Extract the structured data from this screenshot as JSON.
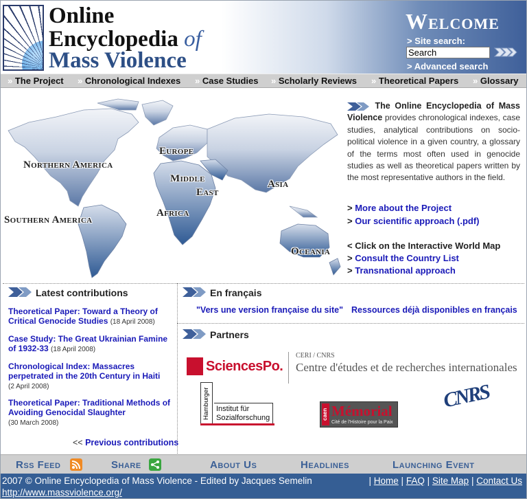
{
  "header": {
    "title_line1": "Online",
    "title_line2": "Encyclopedia",
    "title_of": "of",
    "title_line3": "Mass Violence",
    "welcome": "Welcome",
    "site_search_label": "> Site search:",
    "search_value": "Search",
    "advanced_search": "> Advanced search"
  },
  "nav": [
    "The Project",
    "Chronological Indexes",
    "Case Studies",
    "Scholarly Reviews",
    "Theoretical Papers",
    "Glossary"
  ],
  "map": {
    "regions": [
      "Northern America",
      "Europe",
      "Middle",
      "East",
      "Asia",
      "Africa",
      "Southern America",
      "Oceania"
    ]
  },
  "intro": {
    "lead": "The Online Encyclopedia of Mass Violence",
    "body": " provides chronological indexes, case studies, analytical contributions on socio-political violence in a given country, a glossary of the terms most often used in genocide studies as well as theoretical papers written by the most representative authors in the field.",
    "more_about": "More about the Project",
    "scientific": "Our scientific approach (.pdf)",
    "click_map": "< Click on the Interactive World Map",
    "country_list": "Consult the Country List",
    "transnational": "Transnational approach",
    "gt": ">"
  },
  "latest": {
    "heading": "Latest contributions",
    "items": [
      {
        "title": "Theoretical Paper: Toward a Theory of Critical Genocide Studies",
        "date": "(18 April 2008)"
      },
      {
        "title": "Case Study: The Great Ukrainian Famine of 1932-33",
        "date": "(18 April 2008)"
      },
      {
        "title": "Chronological Index: Massacres perpetrated in the 20th Century in Haiti",
        "date": "(2 April 2008)"
      },
      {
        "title": "Theoretical Paper: Traditional Methods of Avoiding Genocidal Slaughter",
        "date": "(30 March 2008)"
      }
    ],
    "previous_prefix": "<<",
    "previous": "Previous contributions"
  },
  "french": {
    "heading": "En français",
    "link1": "\"Vers une version française du site\"",
    "link2": "Ressources déjà disponibles en français"
  },
  "partners": {
    "heading": "Partners",
    "sciencespo": "SciencesPo.",
    "ceri_small": "CERI / CNRS",
    "ceri_big": "Centre d'études et de recherches internationales",
    "hamburger_vertical": "Hamburger",
    "hamburger_text": "Institut für Sozialforschung",
    "memorial_caen": "caen",
    "memorial_big": "Mémorial",
    "memorial_small": "Cité de l'Histoire pour la Paix",
    "cnrs": "CNRS"
  },
  "footer": {
    "rss": "Rss Feed",
    "share": "Share",
    "about": "About Us",
    "headlines": "Headlines",
    "launching": "Launching Event",
    "copyright": "2007 © Online Encyclopedia of Mass Violence - Edited by Jacques Semelin",
    "url": "http://www.massviolence.org/",
    "links": [
      "Home",
      "FAQ",
      "Site Map",
      "Contact Us"
    ],
    "sep": "|"
  },
  "colors": {
    "accent_blue": "#355e94",
    "link_blue": "#1a1ab8",
    "rss_orange": "#f08a24",
    "share_green": "#3aa640"
  }
}
